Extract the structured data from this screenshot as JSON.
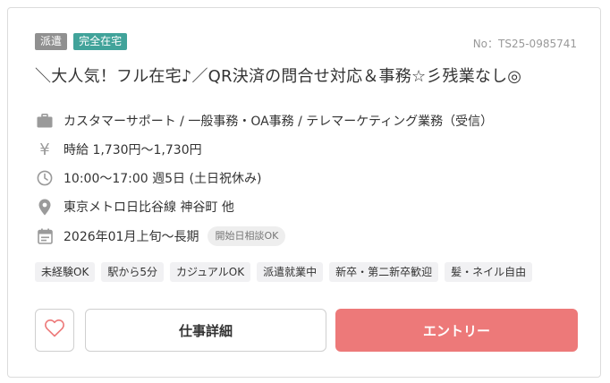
{
  "card": {
    "tags": [
      "派遣",
      "完全在宅"
    ],
    "job_no": "No：TS25-0985741",
    "title": "＼大人気！フル在宅♪／QR決済の問合せ対応＆事務☆彡残業なし◎",
    "details": {
      "job_type": "カスタマーサポート / 一般事務・OA事務 / テレマーケティング業務（受信）",
      "salary_icon": "¥",
      "salary": "時給 1,730円〜1,730円",
      "hours": "10:00〜17:00 週5日 (土日祝休み)",
      "location": "東京メトロ日比谷線 神谷町 他",
      "period": "2026年01月上旬〜長期",
      "start_badge": "開始日相談OK"
    },
    "features": [
      "未経験OK",
      "駅から5分",
      "カジュアルOK",
      "派遣就業中",
      "新卒・第二新卒歓迎",
      "髪・ネイル自由"
    ],
    "buttons": {
      "detail": "仕事詳細",
      "entry": "エントリー"
    }
  },
  "icons": [
    "briefcase-icon",
    "yen-icon",
    "clock-icon",
    "location-pin-icon",
    "calendar-icon",
    "heart-icon"
  ],
  "colors": {
    "accent_entry": "#ed7979",
    "tag_gray": "#909090",
    "tag_green": "#41a39a",
    "icon_gray": "#9a9a9a"
  }
}
